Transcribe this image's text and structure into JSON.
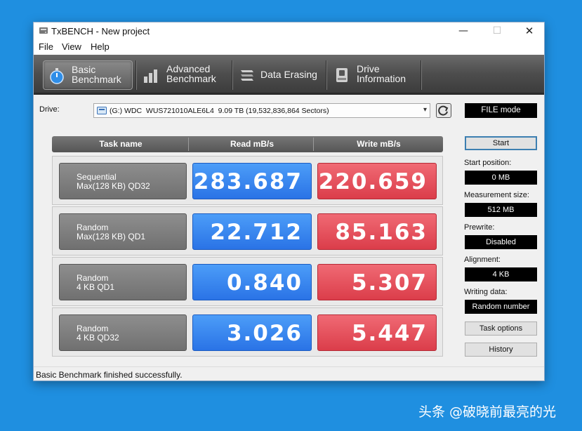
{
  "window": {
    "title": "TxBENCH - New project",
    "min": "—",
    "max": "☐",
    "close": "✕"
  },
  "menu": [
    "File",
    "View",
    "Help"
  ],
  "toolbar": {
    "tabs": [
      {
        "label": "Basic\nBenchmark",
        "icon": "stopwatch-icon",
        "active": true
      },
      {
        "label": "Advanced\nBenchmark",
        "icon": "bar-chart-icon",
        "active": false
      },
      {
        "label": "Data Erasing",
        "icon": "eraser-icon",
        "active": false
      },
      {
        "label": "Drive\nInformation",
        "icon": "drive-info-icon",
        "active": false
      }
    ]
  },
  "drive": {
    "label": "Drive:",
    "value": "(G:) WDC  WUS721010ALE6L4  9.09 TB (19,532,836,864 Sectors)"
  },
  "side": {
    "mode": "FILE mode",
    "start_button": "Start",
    "start_position_label": "Start position:",
    "start_position": "0 MB",
    "measurement_size_label": "Measurement size:",
    "measurement_size": "512 MB",
    "prewrite_label": "Prewrite:",
    "prewrite": "Disabled",
    "alignment_label": "Alignment:",
    "alignment": "4 KB",
    "writing_data_label": "Writing data:",
    "writing_data": "Random number",
    "task_options_button": "Task options",
    "history_button": "History"
  },
  "table": {
    "headers": [
      "Task name",
      "Read mB/s",
      "Write mB/s"
    ],
    "rows": [
      {
        "line1": "Sequential",
        "line2": "Max(128 KB) QD32",
        "read": "283.687",
        "write": "220.659"
      },
      {
        "line1": "Random",
        "line2": "Max(128 KB) QD1",
        "read": "22.712",
        "write": "85.163"
      },
      {
        "line1": "Random",
        "line2": "4 KB QD1",
        "read": "0.840",
        "write": "5.307"
      },
      {
        "line1": "Random",
        "line2": "4 KB QD32",
        "read": "3.026",
        "write": "5.447"
      }
    ]
  },
  "status": "Basic Benchmark finished successfully.",
  "watermark": "头条 @破晓前最亮的光",
  "colors": {
    "read": "#3a88f0",
    "write": "#e5525e",
    "desktop": "#1f8fe0"
  }
}
